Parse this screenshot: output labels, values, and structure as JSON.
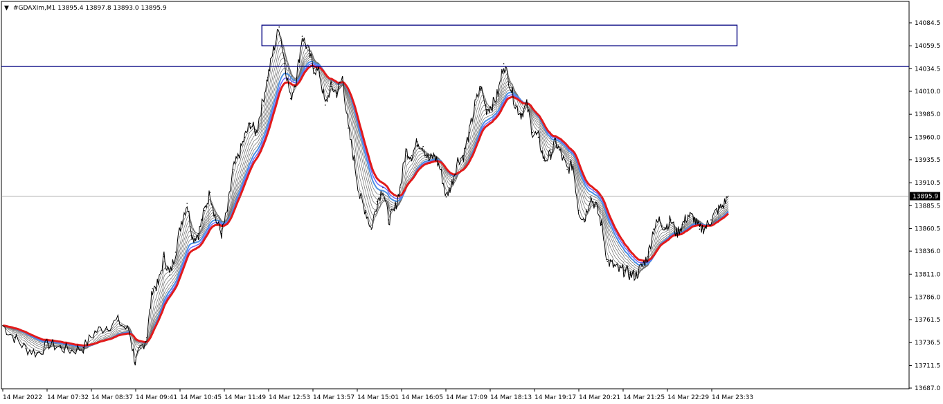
{
  "header": {
    "menu_arrow": "▼",
    "title": "#GDAXIm,M1  13895.4 13897.8 13893.0 13895.9"
  },
  "chart_data": {
    "type": "line",
    "symbol": "#GDAXIm",
    "timeframe": "M1",
    "ohlc": {
      "open": 13895.4,
      "high": 13897.8,
      "low": 13893.0,
      "close": 13895.9
    },
    "current_price_label": "13895.9",
    "y_ticks": [
      "14084.5",
      "14059.5",
      "14034.5",
      "14010.0",
      "13985.0",
      "13960.0",
      "13935.5",
      "13910.5",
      "13885.5",
      "13860.5",
      "13836.0",
      "13811.0",
      "13786.0",
      "13761.5",
      "13736.5",
      "13711.5",
      "13687.0"
    ],
    "x_ticks": [
      "14 Mar 2022",
      "14 Mar 07:32",
      "14 Mar 08:37",
      "14 Mar 09:41",
      "14 Mar 10:45",
      "14 Mar 11:49",
      "14 Mar 12:53",
      "14 Mar 13:57",
      "14 Mar 15:01",
      "14 Mar 16:05",
      "14 Mar 17:09",
      "14 Mar 18:13",
      "14 Mar 19:17",
      "14 Mar 20:21",
      "14 Mar 21:25",
      "14 Mar 22:29",
      "14 Mar 23:33"
    ],
    "ylim": [
      13687.0,
      14102.0
    ],
    "grid": false,
    "price_series": {
      "name": "#GDAXIm,M1",
      "points": [
        [
          0,
          13755
        ],
        [
          8,
          13742
        ],
        [
          16,
          13730
        ],
        [
          24,
          13725
        ],
        [
          32,
          13735
        ],
        [
          40,
          13731
        ],
        [
          48,
          13728
        ],
        [
          56,
          13731
        ],
        [
          64,
          13748
        ],
        [
          72,
          13754
        ],
        [
          80,
          13760
        ],
        [
          88,
          13748
        ],
        [
          92,
          13715
        ],
        [
          96,
          13730
        ],
        [
          100,
          13742
        ],
        [
          104,
          13795
        ],
        [
          108,
          13800
        ],
        [
          112,
          13830
        ],
        [
          116,
          13810
        ],
        [
          120,
          13835
        ],
        [
          124,
          13868
        ],
        [
          128,
          13888
        ],
        [
          132,
          13850
        ],
        [
          136,
          13855
        ],
        [
          140,
          13880
        ],
        [
          144,
          13900
        ],
        [
          148,
          13870
        ],
        [
          152,
          13855
        ],
        [
          156,
          13880
        ],
        [
          160,
          13925
        ],
        [
          164,
          13940
        ],
        [
          168,
          13960
        ],
        [
          172,
          13975
        ],
        [
          176,
          13965
        ],
        [
          180,
          13995
        ],
        [
          184,
          14025
        ],
        [
          188,
          14055
        ],
        [
          192,
          14080
        ],
        [
          196,
          14040
        ],
        [
          200,
          14002
        ],
        [
          204,
          14025
        ],
        [
          208,
          14070
        ],
        [
          212,
          14055
        ],
        [
          216,
          14035
        ],
        [
          220,
          14030
        ],
        [
          224,
          13995
        ],
        [
          228,
          14015
        ],
        [
          232,
          14008
        ],
        [
          236,
          14025
        ],
        [
          240,
          13970
        ],
        [
          244,
          13935
        ],
        [
          248,
          13895
        ],
        [
          252,
          13880
        ],
        [
          256,
          13860
        ],
        [
          260,
          13890
        ],
        [
          264,
          13905
        ],
        [
          268,
          13870
        ],
        [
          272,
          13880
        ],
        [
          276,
          13905
        ],
        [
          280,
          13945
        ],
        [
          284,
          13940
        ],
        [
          288,
          13955
        ],
        [
          292,
          13950
        ],
        [
          296,
          13935
        ],
        [
          300,
          13940
        ],
        [
          304,
          13925
        ],
        [
          308,
          13895
        ],
        [
          312,
          13910
        ],
        [
          316,
          13935
        ],
        [
          320,
          13940
        ],
        [
          324,
          13965
        ],
        [
          328,
          13995
        ],
        [
          332,
          14015
        ],
        [
          336,
          13990
        ],
        [
          340,
          13995
        ],
        [
          344,
          14008
        ],
        [
          348,
          14040
        ],
        [
          352,
          14020
        ],
        [
          356,
          13995
        ],
        [
          360,
          13985
        ],
        [
          364,
          13995
        ],
        [
          368,
          13965
        ],
        [
          372,
          13960
        ],
        [
          376,
          13935
        ],
        [
          380,
          13940
        ],
        [
          384,
          13955
        ],
        [
          388,
          13940
        ],
        [
          392,
          13925
        ],
        [
          396,
          13930
        ],
        [
          400,
          13880
        ],
        [
          404,
          13870
        ],
        [
          408,
          13895
        ],
        [
          412,
          13885
        ],
        [
          416,
          13865
        ],
        [
          420,
          13825
        ],
        [
          424,
          13820
        ],
        [
          428,
          13815
        ],
        [
          432,
          13815
        ],
        [
          436,
          13810
        ],
        [
          440,
          13810
        ],
        [
          444,
          13820
        ],
        [
          448,
          13830
        ],
        [
          452,
          13860
        ],
        [
          456,
          13870
        ],
        [
          460,
          13862
        ],
        [
          464,
          13870
        ],
        [
          468,
          13855
        ],
        [
          472,
          13865
        ],
        [
          476,
          13875
        ],
        [
          480,
          13872
        ],
        [
          484,
          13860
        ],
        [
          488,
          13862
        ],
        [
          492,
          13870
        ],
        [
          496,
          13880
        ],
        [
          500,
          13885
        ],
        [
          504,
          13895.9
        ]
      ]
    },
    "ma_ribbon_count": 10,
    "horizontal_level": 14037.0,
    "rectangle": {
      "x_range": [
        180,
        510
      ],
      "y_range": [
        14059.5,
        14082.0
      ]
    }
  }
}
